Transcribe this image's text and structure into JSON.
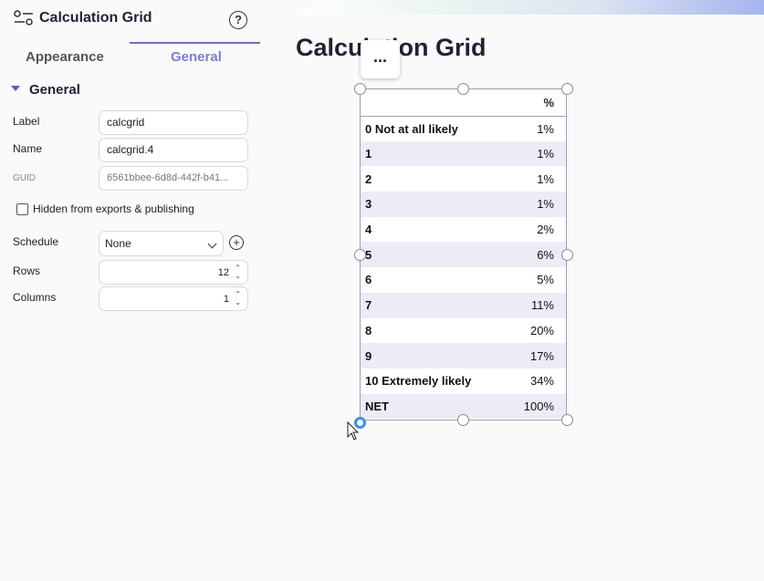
{
  "panel": {
    "title": "Calculation Grid",
    "help_symbol": "?",
    "icons": {
      "panel": "sliders-icon",
      "help": "help-icon"
    }
  },
  "tabs": [
    {
      "label": "Appearance",
      "active": false
    },
    {
      "label": "General",
      "active": true
    }
  ],
  "section": {
    "title": "General"
  },
  "fields": {
    "label": {
      "label": "Label",
      "value": "calcgrid"
    },
    "name": {
      "label": "Name",
      "value": "calcgrid.4"
    },
    "guid": {
      "label": "GUID",
      "value": "6561bbee-6d8d-442f-b41..."
    }
  },
  "hidden_checkbox": {
    "label": "Hidden from exports & publishing",
    "checked": false
  },
  "schedule": {
    "label": "Schedule",
    "value": "None"
  },
  "rows": {
    "label": "Rows",
    "value": "12"
  },
  "columns": {
    "label": "Columns",
    "value": "1"
  },
  "canvas": {
    "title": "Calculation Grid",
    "more_label": "..."
  },
  "grid": {
    "header": [
      "",
      "%"
    ],
    "rows": [
      {
        "label": "0 Not at all likely",
        "value": "1%"
      },
      {
        "label": "1",
        "value": "1%"
      },
      {
        "label": "2",
        "value": "1%"
      },
      {
        "label": "3",
        "value": "1%"
      },
      {
        "label": "4",
        "value": "2%"
      },
      {
        "label": "5",
        "value": "6%"
      },
      {
        "label": "6",
        "value": "5%"
      },
      {
        "label": "7",
        "value": "11%"
      },
      {
        "label": "8",
        "value": "20%"
      },
      {
        "label": "9",
        "value": "17%"
      },
      {
        "label": "10 Extremely likely",
        "value": "34%"
      },
      {
        "label": "NET",
        "value": "100%"
      }
    ]
  },
  "colors": {
    "accent": "#6a6ec8",
    "tab_active": "#7a7fd0",
    "row_alt": "#ececf7",
    "handle_active": "#3b8ee8"
  }
}
